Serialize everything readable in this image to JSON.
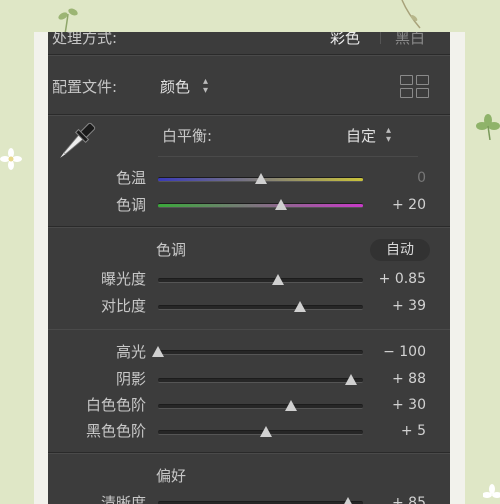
{
  "top": {
    "method_label": "处理方式:",
    "color": "彩色",
    "bw": "黑白"
  },
  "profile": {
    "label": "配置文件:",
    "value": "颜色"
  },
  "wb": {
    "label": "白平衡:",
    "value": "自定"
  },
  "temp": {
    "label": "色温",
    "value": "0",
    "level": 0.5
  },
  "tint": {
    "label": "色调",
    "value": "+ 20",
    "level": 0.6
  },
  "tone": {
    "title": "色调",
    "auto": "自动"
  },
  "exposure": {
    "label": "曝光度",
    "value": "+ 0.85",
    "level": 0.585
  },
  "contrast": {
    "label": "对比度",
    "value": "+ 39",
    "level": 0.695
  },
  "highlights": {
    "label": "高光",
    "value": "− 100",
    "level": 0.0
  },
  "shadows": {
    "label": "阴影",
    "value": "+ 88",
    "level": 0.94
  },
  "whites": {
    "label": "白色色阶",
    "value": "+ 30",
    "level": 0.65
  },
  "blacks": {
    "label": "黑色色阶",
    "value": "+ 5",
    "level": 0.525
  },
  "presence": {
    "title": "偏好"
  },
  "clarity": {
    "label": "清晰度",
    "value": "+ 85",
    "level": 0.925
  },
  "colors": {
    "temp_start": "#3a3ab8",
    "temp_end": "#c9c23a",
    "tint_start": "#3aa83a",
    "tint_end": "#c83ac8"
  }
}
